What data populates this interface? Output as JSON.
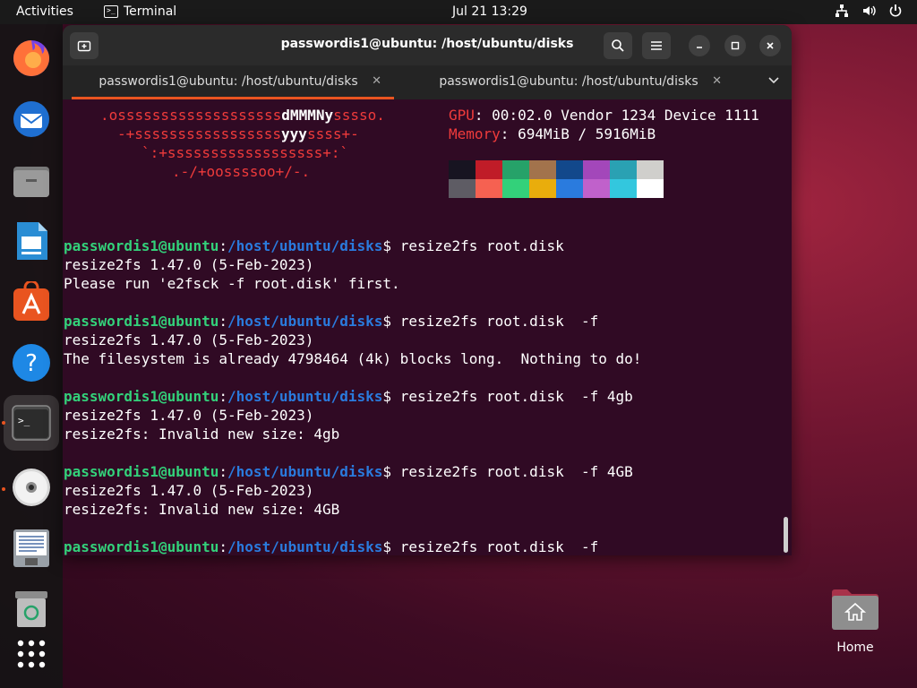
{
  "topbar": {
    "activities": "Activities",
    "app_name": "Terminal",
    "clock": "Jul 21  13:29"
  },
  "dock": {
    "items": [
      {
        "name": "firefox-icon"
      },
      {
        "name": "thunderbird-icon"
      },
      {
        "name": "files-icon"
      },
      {
        "name": "libreoffice-writer-icon"
      },
      {
        "name": "app-center-icon"
      },
      {
        "name": "help-icon"
      },
      {
        "name": "terminal-icon"
      },
      {
        "name": "disc-icon"
      },
      {
        "name": "text-editor-icon"
      },
      {
        "name": "trash-icon"
      },
      {
        "name": "show-apps-icon"
      }
    ]
  },
  "window": {
    "title": "passwordis1@ubuntu: /host/ubuntu/disks"
  },
  "tabs": [
    {
      "label": "passwordis1@ubuntu: /host/ubuntu/disks",
      "active": true
    },
    {
      "label": "passwordis1@ubuntu: /host/ubuntu/disks",
      "active": false
    }
  ],
  "neofetch": {
    "logo": [
      {
        "pre": ".osssssssssssssssssss",
        "bold": "dMMMNy",
        "post": "sssso."
      },
      {
        "pre": "-+sssssssssssssssss",
        "bold": "yyy",
        "post": "ssss+-"
      },
      {
        "pre": "`:+ssssssssssssssssss+:`",
        "bold": "",
        "post": ""
      },
      {
        "pre": ".-/+oossssoo+/-.",
        "bold": "",
        "post": ""
      }
    ],
    "info": [
      {
        "key": "GPU",
        "value": ": 00:02.0 Vendor 1234 Device 1111"
      },
      {
        "key": "Memory",
        "value": ": 694MiB / 5916MiB"
      }
    ],
    "palette_top": [
      "#171421",
      "#c01c28",
      "#26a269",
      "#a2734c",
      "#12488b",
      "#a347ba",
      "#2aa1b3",
      "#d0cfcc"
    ],
    "palette_bottom": [
      "#5e5c64",
      "#f66151",
      "#33d17a",
      "#e9ad0c",
      "#2a7bde",
      "#c061cb",
      "#33c7de",
      "#ffffff"
    ]
  },
  "prompt": {
    "user": "passwordis1@ubuntu",
    "sep": ":",
    "path": "/host/ubuntu/disks",
    "dollar": "$ "
  },
  "session": [
    {
      "cmd": "resize2fs root.disk",
      "out": [
        "resize2fs 1.47.0 (5-Feb-2023)",
        "Please run 'e2fsck -f root.disk' first."
      ]
    },
    {
      "cmd": "resize2fs root.disk  -f",
      "out": [
        "resize2fs 1.47.0 (5-Feb-2023)",
        "The filesystem is already 4798464 (4k) blocks long.  Nothing to do!"
      ]
    },
    {
      "cmd": "resize2fs root.disk  -f 4gb",
      "out": [
        "resize2fs 1.47.0 (5-Feb-2023)",
        "resize2fs: Invalid new size: 4gb"
      ]
    },
    {
      "cmd": "resize2fs root.disk  -f 4GB",
      "out": [
        "resize2fs 1.47.0 (5-Feb-2023)",
        "resize2fs: Invalid new size: 4GB"
      ]
    },
    {
      "cmd": "resize2fs root.disk  -f",
      "out": []
    }
  ],
  "desktop": {
    "home_label": "Home"
  }
}
